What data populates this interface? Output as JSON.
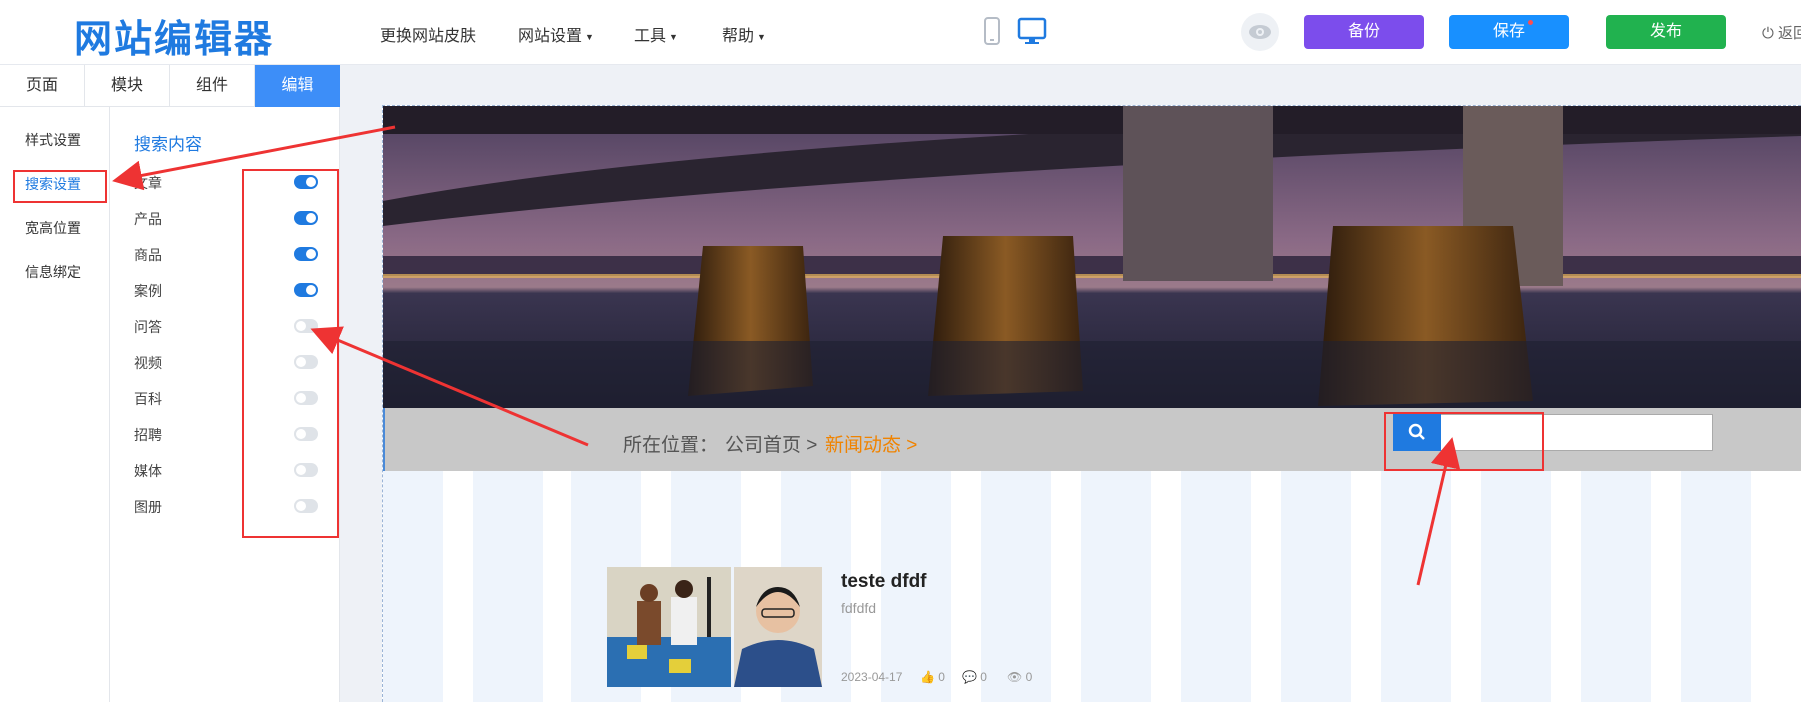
{
  "header": {
    "logo": "网站编辑器",
    "menu": [
      "更换网站皮肤",
      "网站设置",
      "工具",
      "帮助"
    ],
    "backup_label": "备份",
    "save_label": "保存",
    "publish_label": "发布",
    "exit_label": "返回",
    "colors": {
      "backup": "#7c4dec",
      "save": "#1890ff",
      "publish": "#21b24f"
    }
  },
  "sidebar": {
    "tabs": [
      "页面",
      "模块",
      "组件",
      "编辑"
    ],
    "active_tab": "编辑",
    "nav_items": [
      "样式设置",
      "搜索设置",
      "宽高位置",
      "信息绑定"
    ],
    "selected_nav": "搜索设置",
    "section_title": "搜索内容",
    "options": [
      {
        "label": "文章",
        "on": true
      },
      {
        "label": "产品",
        "on": true
      },
      {
        "label": "商品",
        "on": true
      },
      {
        "label": "案例",
        "on": true
      },
      {
        "label": "问答",
        "on": false
      },
      {
        "label": "视频",
        "on": false
      },
      {
        "label": "百科",
        "on": false
      },
      {
        "label": "招聘",
        "on": false
      },
      {
        "label": "媒体",
        "on": false
      },
      {
        "label": "图册",
        "on": false
      }
    ]
  },
  "canvas": {
    "breadcrumb": {
      "prefix": "所在位置：",
      "home": "公司首页 >",
      "current": "新闻动态 >"
    },
    "news": {
      "title": "teste dfdf",
      "desc": "fdfdfd",
      "date": "2023-04-17",
      "likes": "0",
      "comments": "0",
      "views": "0"
    }
  }
}
